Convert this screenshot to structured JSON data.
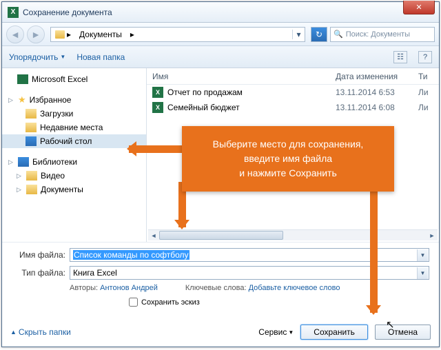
{
  "window": {
    "title": "Сохранение документа"
  },
  "breadcrumb": {
    "location": "Документы"
  },
  "search": {
    "placeholder": "Поиск: Документы"
  },
  "toolbar": {
    "organize": "Упорядочить",
    "new_folder": "Новая папка"
  },
  "sidebar": {
    "excel": "Microsoft Excel",
    "favorites": "Избранное",
    "downloads": "Загрузки",
    "recent": "Недавние места",
    "desktop": "Рабочий стол",
    "libraries": "Библиотеки",
    "video": "Видео",
    "documents": "Документы"
  },
  "columns": {
    "name": "Имя",
    "date": "Дата изменения",
    "type": "Ти"
  },
  "files": [
    {
      "name": "Отчет по продажам",
      "date": "13.11.2014 6:53",
      "type": "Ли"
    },
    {
      "name": "Семейный бюджет",
      "date": "13.11.2014 6:08",
      "type": "Ли"
    }
  ],
  "form": {
    "filename_label": "Имя файла:",
    "filename_value": "Список команды по софтболу",
    "filetype_label": "Тип файла:",
    "filetype_value": "Книга Excel",
    "authors_label": "Авторы:",
    "authors_value": "Антонов Андрей",
    "keywords_label": "Ключевые слова:",
    "keywords_value": "Добавьте ключевое слово",
    "thumb_checkbox": "Сохранить эскиз"
  },
  "footer": {
    "hide_folders": "Скрыть папки",
    "service": "Сервис",
    "save": "Сохранить",
    "cancel": "Отмена"
  },
  "callout": {
    "line1": "Выберите место для сохранения,",
    "line2": "введите имя файла",
    "line3": "и нажмите Сохранить"
  }
}
